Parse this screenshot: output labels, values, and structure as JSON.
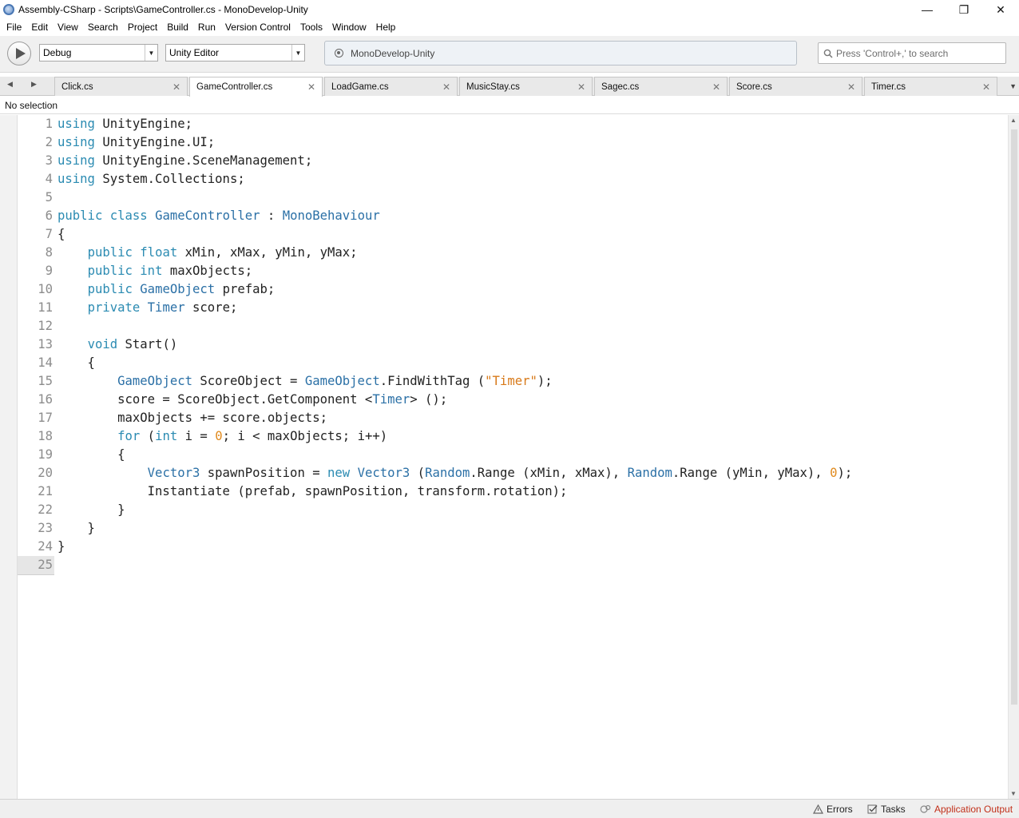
{
  "window": {
    "title": "Assembly-CSharp - Scripts\\GameController.cs - MonoDevelop-Unity",
    "controls": {
      "minimize": "—",
      "restore": "❐",
      "close": "✕"
    }
  },
  "menu": [
    "File",
    "Edit",
    "View",
    "Search",
    "Project",
    "Build",
    "Run",
    "Version Control",
    "Tools",
    "Window",
    "Help"
  ],
  "toolbar": {
    "configuration": "Debug",
    "target": "Unity Editor",
    "status": "MonoDevelop-Unity",
    "search_placeholder": "Press 'Control+,' to search"
  },
  "tabs": [
    {
      "label": "Click.cs",
      "active": false
    },
    {
      "label": "GameController.cs",
      "active": true
    },
    {
      "label": "LoadGame.cs",
      "active": false
    },
    {
      "label": "MusicStay.cs",
      "active": false
    },
    {
      "label": "Sagec.cs",
      "active": false
    },
    {
      "label": "Score.cs",
      "active": false
    },
    {
      "label": "Timer.cs",
      "active": false
    }
  ],
  "breadcrumb": "No selection",
  "editor": {
    "current_line": 25,
    "lines": [
      [
        [
          "kw",
          "using"
        ],
        [
          "pl",
          " UnityEngine;"
        ]
      ],
      [
        [
          "kw",
          "using"
        ],
        [
          "pl",
          " UnityEngine.UI;"
        ]
      ],
      [
        [
          "kw",
          "using"
        ],
        [
          "pl",
          " UnityEngine.SceneManagement;"
        ]
      ],
      [
        [
          "kw",
          "using"
        ],
        [
          "pl",
          " System.Collections;"
        ]
      ],
      [],
      [
        [
          "kw",
          "public"
        ],
        [
          "pl",
          " "
        ],
        [
          "kw",
          "class"
        ],
        [
          "pl",
          " "
        ],
        [
          "ty",
          "GameController"
        ],
        [
          "pl",
          " : "
        ],
        [
          "ty",
          "MonoBehaviour"
        ]
      ],
      [
        [
          "pl",
          "{"
        ]
      ],
      [
        [
          "pl",
          "    "
        ],
        [
          "kw",
          "public"
        ],
        [
          "pl",
          " "
        ],
        [
          "kw",
          "float"
        ],
        [
          "pl",
          " xMin, xMax, yMin, yMax;"
        ]
      ],
      [
        [
          "pl",
          "    "
        ],
        [
          "kw",
          "public"
        ],
        [
          "pl",
          " "
        ],
        [
          "kw",
          "int"
        ],
        [
          "pl",
          " maxObjects;"
        ]
      ],
      [
        [
          "pl",
          "    "
        ],
        [
          "kw",
          "public"
        ],
        [
          "pl",
          " "
        ],
        [
          "ty",
          "GameObject"
        ],
        [
          "pl",
          " prefab;"
        ]
      ],
      [
        [
          "pl",
          "    "
        ],
        [
          "kw",
          "private"
        ],
        [
          "pl",
          " "
        ],
        [
          "ty",
          "Timer"
        ],
        [
          "pl",
          " score;"
        ]
      ],
      [],
      [
        [
          "pl",
          "    "
        ],
        [
          "kw",
          "void"
        ],
        [
          "pl",
          " Start()"
        ]
      ],
      [
        [
          "pl",
          "    {"
        ]
      ],
      [
        [
          "pl",
          "        "
        ],
        [
          "ty",
          "GameObject"
        ],
        [
          "pl",
          " ScoreObject = "
        ],
        [
          "ty",
          "GameObject"
        ],
        [
          "pl",
          ".FindWithTag ("
        ],
        [
          "str",
          "\"Timer\""
        ],
        [
          "pl",
          ");"
        ]
      ],
      [
        [
          "pl",
          "        score = ScoreObject.GetComponent <"
        ],
        [
          "ty",
          "Timer"
        ],
        [
          "pl",
          "> ();"
        ]
      ],
      [
        [
          "pl",
          "        maxObjects += score.objects;"
        ]
      ],
      [
        [
          "pl",
          "        "
        ],
        [
          "kw",
          "for"
        ],
        [
          "pl",
          " ("
        ],
        [
          "kw",
          "int"
        ],
        [
          "pl",
          " i = "
        ],
        [
          "num",
          "0"
        ],
        [
          "pl",
          "; i < maxObjects; i++)"
        ]
      ],
      [
        [
          "pl",
          "        {"
        ]
      ],
      [
        [
          "pl",
          "            "
        ],
        [
          "ty",
          "Vector3"
        ],
        [
          "pl",
          " spawnPosition = "
        ],
        [
          "kw",
          "new"
        ],
        [
          "pl",
          " "
        ],
        [
          "ty",
          "Vector3"
        ],
        [
          "pl",
          " ("
        ],
        [
          "ty",
          "Random"
        ],
        [
          "pl",
          ".Range (xMin, xMax), "
        ],
        [
          "ty",
          "Random"
        ],
        [
          "pl",
          ".Range (yMin, yMax), "
        ],
        [
          "num",
          "0"
        ],
        [
          "pl",
          ");"
        ]
      ],
      [
        [
          "pl",
          "            Instantiate (prefab, spawnPosition, transform.rotation);"
        ]
      ],
      [
        [
          "pl",
          "        }"
        ]
      ],
      [
        [
          "pl",
          "    }"
        ]
      ],
      [
        [
          "pl",
          "}"
        ]
      ],
      []
    ]
  },
  "statusbar": {
    "errors": "Errors",
    "tasks": "Tasks",
    "output": "Application Output"
  },
  "colors": {
    "keyword": "#2b8bb2",
    "type": "#2b70a6",
    "string": "#d87a1a",
    "number": "#e08a1e",
    "output_accent": "#c2301a"
  }
}
